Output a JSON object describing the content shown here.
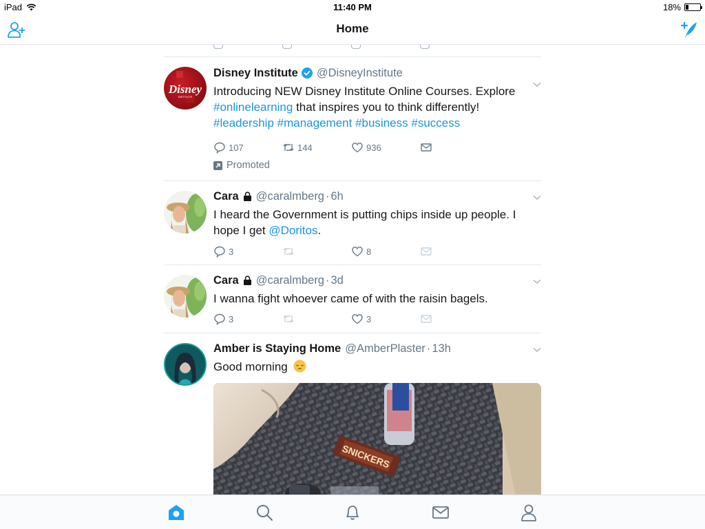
{
  "status_bar": {
    "device": "iPad",
    "time": "11:40 PM",
    "battery_text": "18%",
    "battery_level": 0.18
  },
  "nav": {
    "title": "Home",
    "left_icon": "add-user-icon",
    "right_icon": "compose-tweet-icon"
  },
  "colors": {
    "accent": "#1da1f2",
    "link": "#1b95e0",
    "secondary_text": "#657786",
    "divider": "#e1e8ed"
  },
  "tweets": [
    {
      "name": "Disney Institute",
      "handle": "@DisneyInstitute",
      "verified": true,
      "text_parts": [
        "Introducing NEW Disney Institute Online Courses. Explore",
        "#onlinelearning",
        "that inspires you to think differently!",
        "#leadership",
        "#management",
        "#business",
        "#success"
      ],
      "reply_count": "107",
      "retweet_count": "144",
      "like_count": "936",
      "promoted_label": "Promoted"
    },
    {
      "name": "Cara",
      "handle": "@caralmberg",
      "time": "6h",
      "protected": true,
      "text_parts": [
        "I heard the Government is putting chips inside up people. I hope I get",
        "@Doritos",
        "."
      ],
      "reply_count": "3",
      "like_count": "8"
    },
    {
      "name": "Cara",
      "handle": "@caralmberg",
      "time": "3d",
      "protected": true,
      "text": "I wanna fight whoever came of with the raisin bagels.",
      "reply_count": "3",
      "like_count": "3"
    },
    {
      "name": "Amber is Staying Home",
      "handle": "@AmberPlaster",
      "time": "13h",
      "text": "Good morning",
      "emoji": "sleepy-face-emoji",
      "media": "photo"
    }
  ],
  "tab_bar": [
    {
      "icon": "home-icon",
      "active": true
    },
    {
      "icon": "search-icon",
      "active": false
    },
    {
      "icon": "notifications-bell-icon",
      "active": false
    },
    {
      "icon": "messages-envelope-icon",
      "active": false
    },
    {
      "icon": "profile-icon",
      "active": false
    }
  ],
  "separator": "·"
}
